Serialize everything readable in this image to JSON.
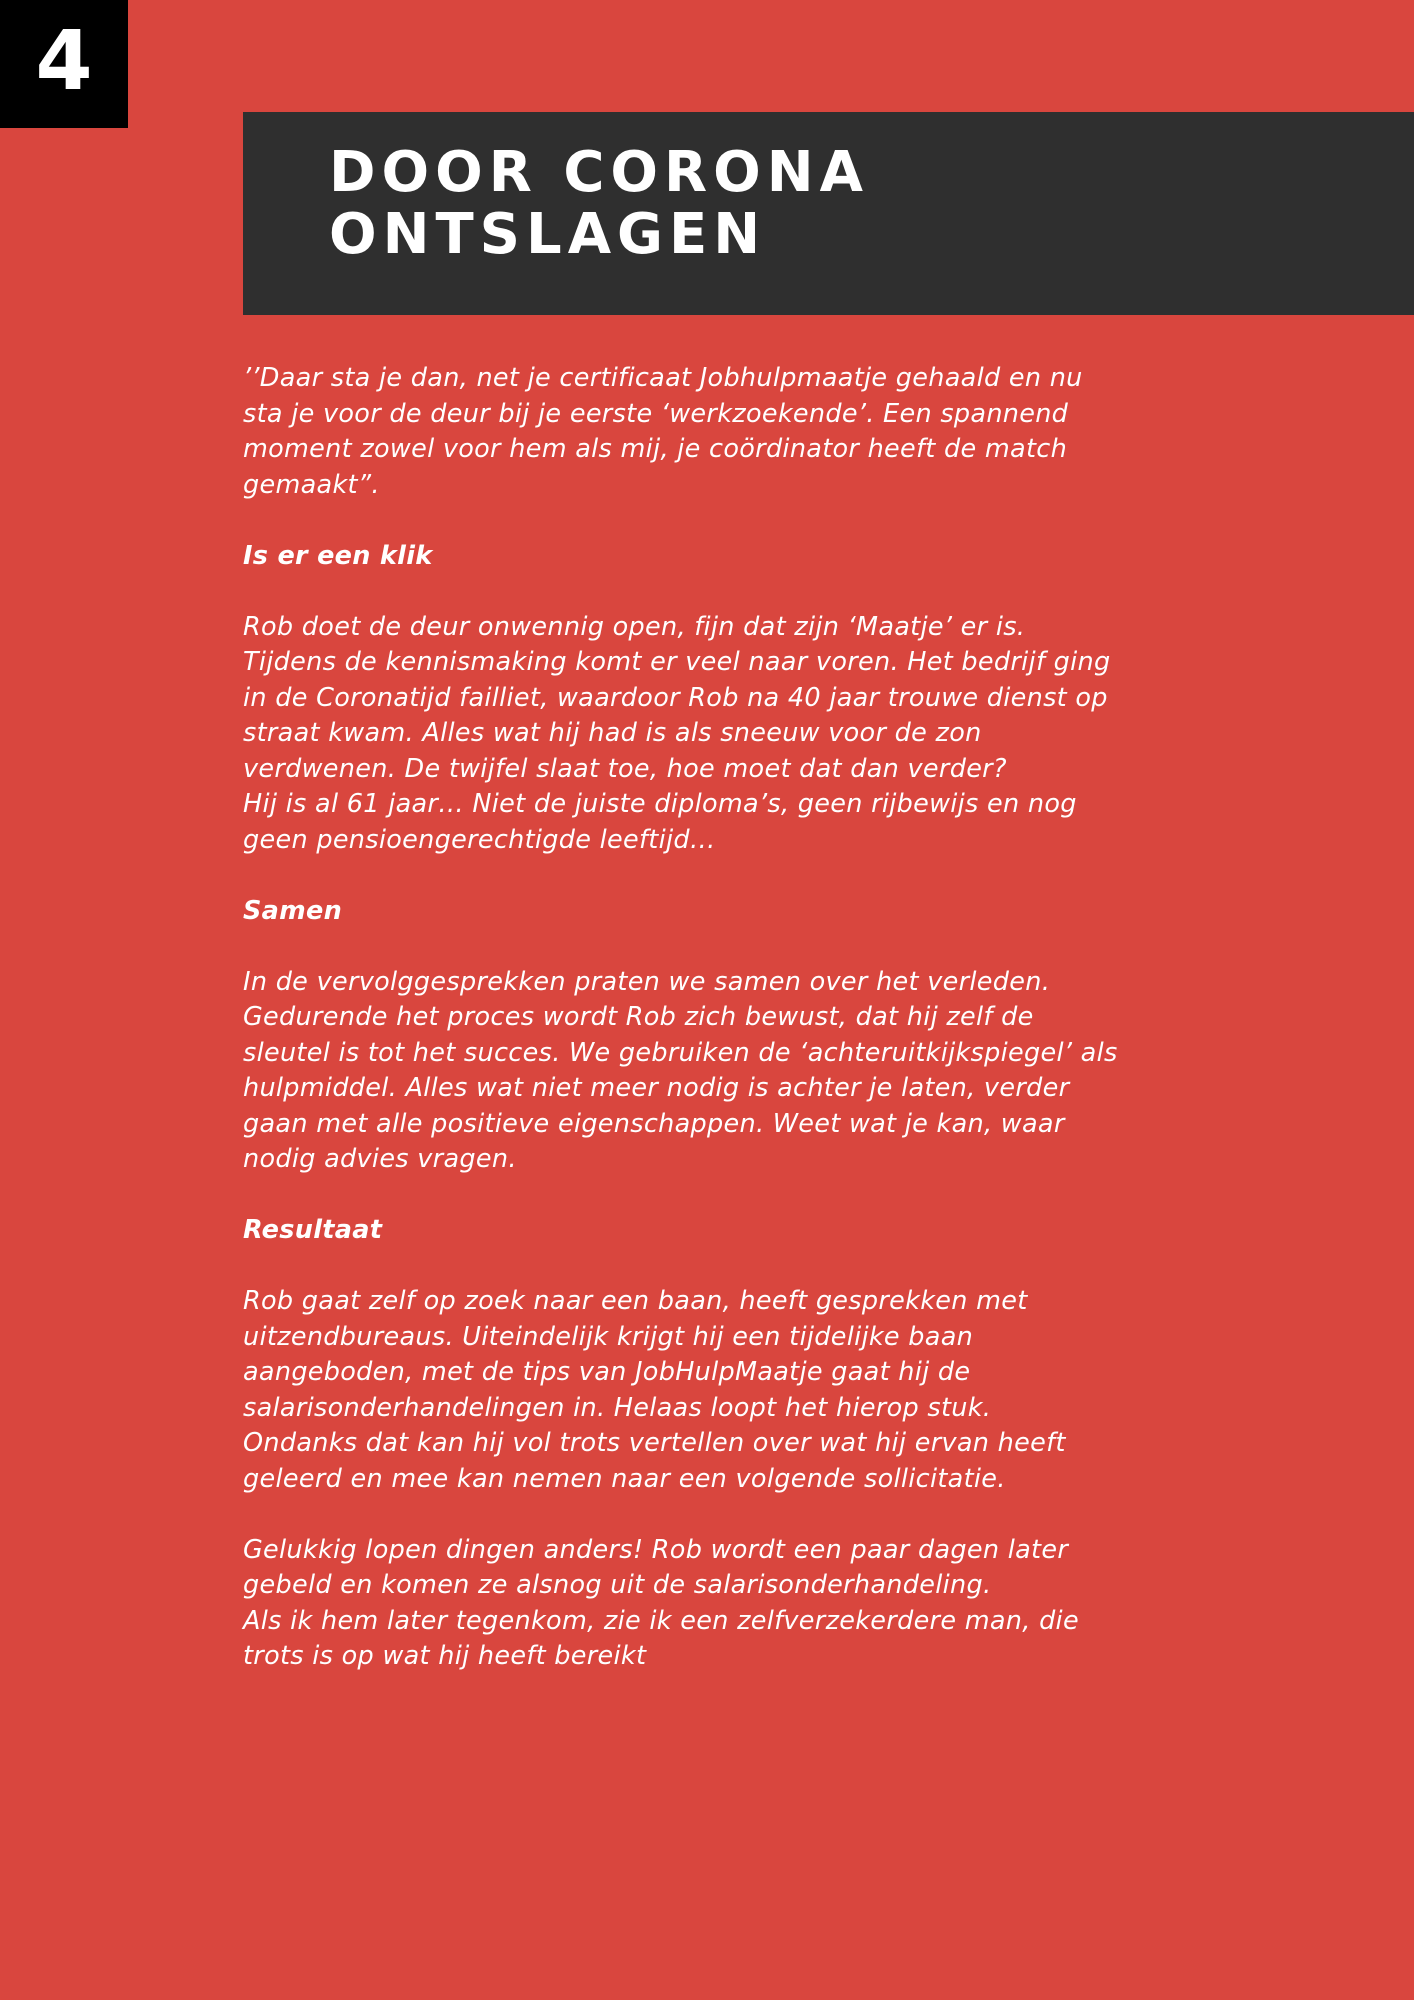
{
  "page_number": "4",
  "title": {
    "line1": "DOOR CORONA",
    "line2": "ONTSLAGEN"
  },
  "intro": {
    "lines": [
      "’’Daar sta je dan, net je certificaat Jobhulpmaatje gehaald en nu",
      "sta je voor de deur bij je eerste ‘werkzoekende’. Een spannend",
      "moment zowel voor hem als mij, je coördinator heeft de match",
      "gemaakt”."
    ]
  },
  "section1": {
    "heading": "Is er een klik",
    "lines": [
      "Rob doet de deur onwennig open, fijn dat zijn ‘Maatje’ er is.",
      "Tijdens de kennismaking komt er veel naar voren. Het bedrijf ging",
      "in de Coronatijd failliet, waardoor Rob na 40 jaar trouwe dienst op",
      "straat kwam. Alles wat hij had is als sneeuw voor de zon",
      "verdwenen. De twijfel slaat toe, hoe moet dat dan verder?",
      "Hij is al 61 jaar… Niet de juiste diploma’s, geen rijbewijs en nog",
      "geen pensioengerechtigde leeftijd…"
    ]
  },
  "section2": {
    "heading": "Samen",
    "lines": [
      "In de vervolggesprekken praten we samen over het verleden.",
      "Gedurende het proces wordt Rob zich bewust, dat hij zelf de",
      "sleutel is tot het succes. We gebruiken de ‘achteruitkijkspiegel’ als",
      "hulpmiddel. Alles wat niet meer nodig is achter je laten, verder",
      "gaan met alle positieve eigenschappen. Weet wat je kan, waar",
      "nodig advies vragen."
    ]
  },
  "section3": {
    "heading": "Resultaat",
    "lines": [
      "Rob gaat zelf op zoek naar een baan, heeft gesprekken met",
      "uitzendbureaus.  Uiteindelijk krijgt hij een tijdelijke baan",
      "aangeboden, met de tips van JobHulpMaatje gaat hij de",
      "salarisonderhandelingen in. Helaas loopt het hierop stuk.",
      "Ondanks dat kan hij vol trots vertellen over wat hij ervan heeft",
      "geleerd en mee kan nemen naar een volgende sollicitatie."
    ],
    "closing_lines": [
      "Gelukkig lopen dingen anders! Rob wordt een paar dagen later",
      "gebeld en komen ze alsnog uit de salarisonderhandeling.",
      "Als ik hem later tegenkom, zie ik een zelfverzekerdere man, die",
      "trots is op wat hij heeft bereikt"
    ]
  },
  "colors": {
    "background": "#d9463e",
    "banner": "#2f2f2f",
    "page_number_box": "#000000",
    "text": "#ffffff"
  }
}
